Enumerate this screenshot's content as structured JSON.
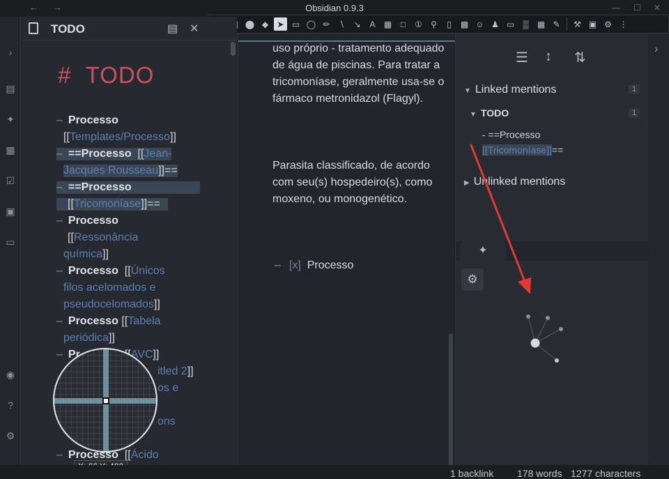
{
  "window": {
    "title": "Obsidian 0.9.3",
    "back_icon": "arrow-left-icon",
    "forward_icon": "arrow-right-icon"
  },
  "left_pane": {
    "title": "TODO",
    "heading_hash": "#",
    "heading": "TODO",
    "lines": [
      {
        "parts": [
          "Processo"
        ]
      },
      {
        "parts": [
          "[[",
          "Templates/Processo",
          "]]"
        ]
      },
      {
        "parts": [
          "==Processo",
          "[[",
          "Jean-"
        ]
      },
      {
        "parts": [
          "Jacques Rousseau",
          "]]=="
        ]
      },
      {
        "parts": [
          "==Processo"
        ]
      },
      {
        "parts": [
          "[[",
          "Tricomoníase",
          "]]=="
        ]
      },
      {
        "parts": [
          "Processo"
        ]
      },
      {
        "parts": [
          "[[",
          "Ressonância"
        ]
      },
      {
        "parts": [
          "química",
          "]]"
        ]
      },
      {
        "parts": [
          "Processo",
          "[[",
          "Únicos"
        ]
      },
      {
        "parts": [
          "filos acelomados e"
        ]
      },
      {
        "parts": [
          "pseudocelomados",
          "]]"
        ]
      },
      {
        "parts": [
          "Processo",
          "[[",
          "Tabela"
        ]
      },
      {
        "parts": [
          "periódica",
          "]]"
        ]
      },
      {
        "parts": [
          "Pr",
          "[[",
          "AVC",
          "]]"
        ]
      },
      {
        "parts": [
          "itled 2",
          "]]"
        ]
      },
      {
        "parts": [
          "os e"
        ]
      },
      {
        "parts": [
          "ons"
        ]
      },
      {
        "parts": [
          "Processo",
          "[[",
          "Ácido"
        ]
      }
    ]
  },
  "magnifier": {
    "coord_text": "X: 66 Y: 490"
  },
  "middle_pane": {
    "paragraph1": "uso próprio - tratamento adequado de água de piscinas. Para tratar a tricomoníase, geralmente usa-se o fármaco metronidazol (Flagyl).",
    "paragraph2": "Parasita classificado, de acordo com seu(s) hospedeiro(s), como moxeno, ou monogenético.",
    "task_checkbox": "[x]",
    "task_label": "Processo"
  },
  "backlinks": {
    "linked_label": "Linked mentions",
    "linked_count": "1",
    "file_label": "TODO",
    "file_count": "1",
    "mention_line1": "- ==Processo",
    "mention_link": "[[Tricomoníase]]",
    "mention_suffix": "==",
    "unlinked_label": "Unlinked mentions"
  },
  "graph": {
    "tab_icon": "graph-icon",
    "settings_icon": "gear-icon",
    "node_color": "#c9ccd1"
  },
  "status": {
    "backlinks": "1 backlink",
    "words": "178 words",
    "characters": "1277 characters"
  },
  "colors": {
    "heading": "#c9525b",
    "link": "#5e7fb0",
    "arrow": "#e53935",
    "accent_line": "#4f7f84"
  }
}
